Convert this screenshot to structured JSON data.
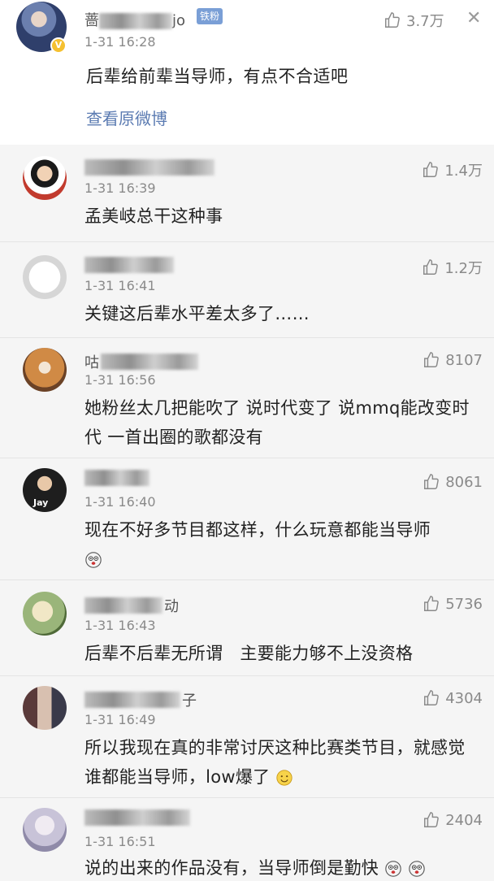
{
  "top_comment": {
    "name_prefix": "蔷",
    "name_suffix": "jo",
    "badge": "铁粉",
    "time": "1-31 16:28",
    "text": "后辈给前辈当导师，有点不合适吧",
    "view_original": "查看原微博",
    "likes": "3.7万",
    "verified_mark": "V"
  },
  "replies": [
    {
      "name_prefix": "",
      "name_suffix": "",
      "time": "1-31 16:39",
      "text": "孟美岐总干这种事",
      "likes": "1.4万",
      "avatar_color": "#c23b2e"
    },
    {
      "name_prefix": "",
      "name_suffix": "",
      "time": "1-31 16:41",
      "text": "关键这后辈水平差太多了……",
      "likes": "1.2万",
      "avatar_color": "#dcdcdc"
    },
    {
      "name_prefix": "咕",
      "name_suffix": "",
      "time": "1-31 16:56",
      "text": "她粉丝太几把能吹了 说时代变了 说mmq能改变时代 一首出圈的歌都没有",
      "likes": "8107",
      "avatar_color": "#b8733a"
    },
    {
      "name_prefix": "",
      "name_suffix": "",
      "time": "1-31 16:40",
      "text": "现在不好多节目都这样，什么玩意都能当导师",
      "likes": "8061",
      "avatar_color": "#2a2a2a",
      "avatar_label": "Jay"
    },
    {
      "name_prefix": "",
      "name_suffix": "动",
      "time": "1-31 16:43",
      "text": "后辈不后辈无所谓   主要能力够不上没资格",
      "likes": "5736",
      "avatar_color": "#7a9a5a"
    },
    {
      "name_prefix": "",
      "name_suffix": "子",
      "time": "1-31 16:49",
      "text": "所以我现在真的非常讨厌这种比赛类节目，就感觉谁都能当导师，low爆了",
      "likes": "4304",
      "avatar_color": "#8a6a6a"
    },
    {
      "name_prefix": "",
      "name_suffix": "",
      "time": "1-31 16:51",
      "text": "说的出来的作品没有，当导师倒是勤快",
      "likes": "2404",
      "avatar_color": "#a9a9c0"
    }
  ],
  "icons": {
    "like": "thumbs-up-icon",
    "close": "close-icon",
    "emoji_scared": "scared-face-emoji",
    "emoji_smile": "smile-emoji"
  }
}
